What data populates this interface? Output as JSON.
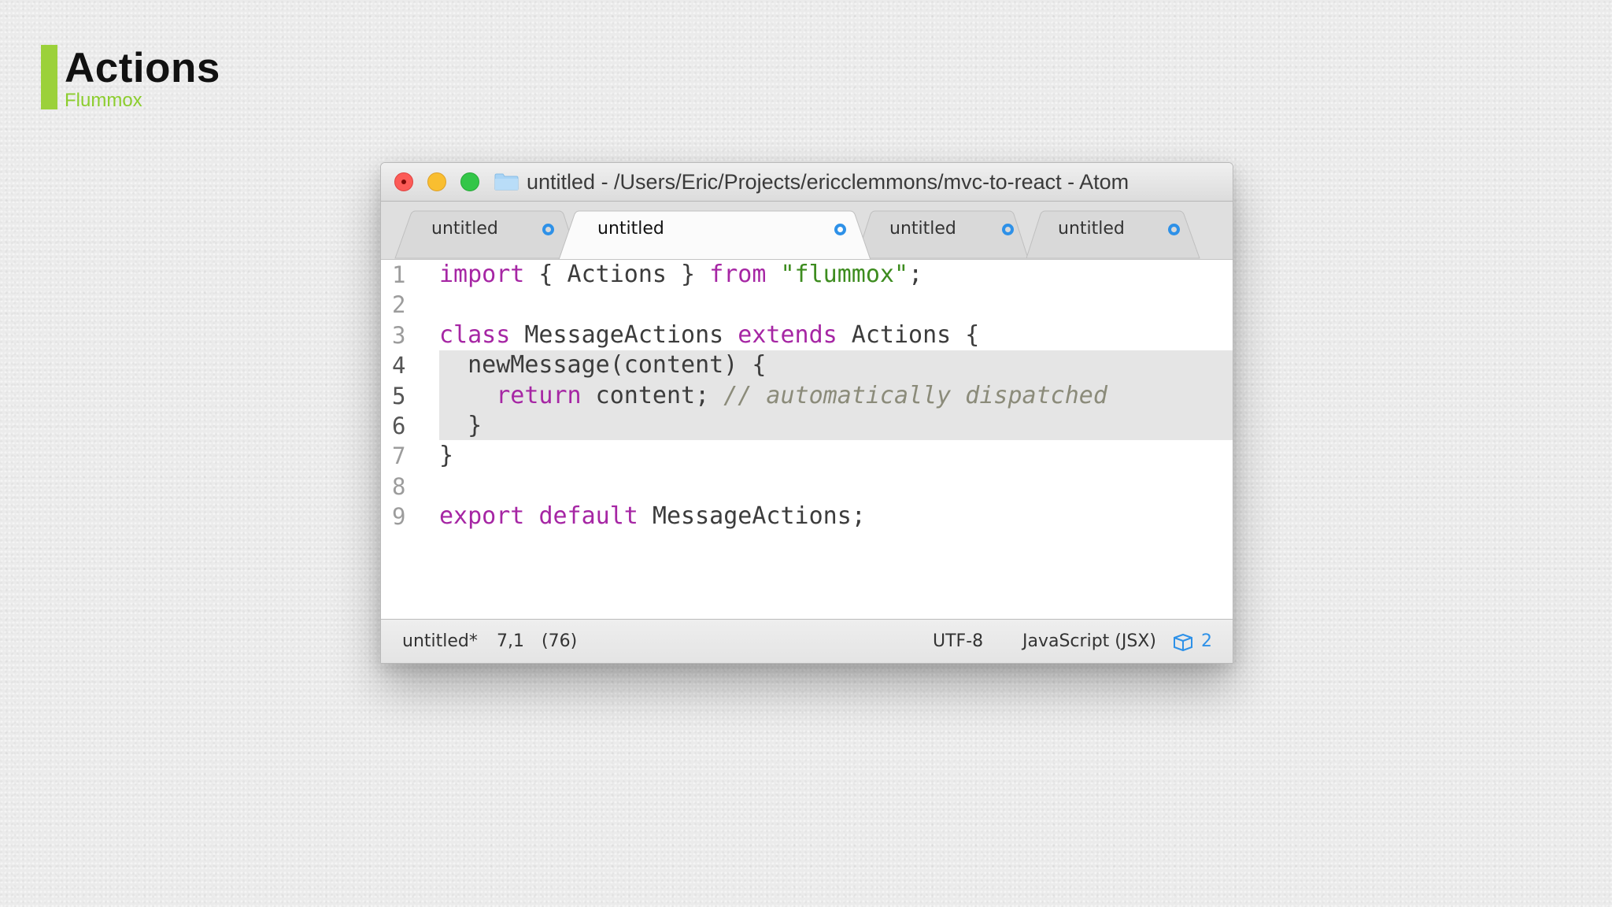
{
  "slide": {
    "title": "Actions",
    "subtitle": "Flummox",
    "accent_color": "#9bd13a"
  },
  "window": {
    "title": "untitled - /Users/Eric/Projects/ericclemmons/mvc-to-react - Atom",
    "traffic_lights": [
      "close",
      "minimize",
      "zoom"
    ],
    "folder_icon": "folder-icon"
  },
  "tabs": [
    {
      "label": "untitled",
      "active": false,
      "modified": true
    },
    {
      "label": "untitled",
      "active": true,
      "modified": true
    },
    {
      "label": "untitled",
      "active": false,
      "modified": true
    },
    {
      "label": "untitled",
      "active": false,
      "modified": true
    }
  ],
  "editor": {
    "lines": [
      {
        "num": "1",
        "tokens": [
          {
            "t": "import",
            "c": "kw"
          },
          {
            "t": " { Actions } ",
            "c": ""
          },
          {
            "t": "from",
            "c": "kw"
          },
          {
            "t": " ",
            "c": ""
          },
          {
            "t": "\"flummox\"",
            "c": "str"
          },
          {
            "t": ";",
            "c": ""
          }
        ]
      },
      {
        "num": "2",
        "tokens": []
      },
      {
        "num": "3",
        "tokens": [
          {
            "t": "class",
            "c": "kw"
          },
          {
            "t": " MessageActions ",
            "c": ""
          },
          {
            "t": "extends",
            "c": "kw"
          },
          {
            "t": " Actions {",
            "c": ""
          }
        ]
      },
      {
        "num": "4",
        "tokens": [
          {
            "t": "  newMessage(content) {",
            "c": ""
          }
        ]
      },
      {
        "num": "5",
        "tokens": [
          {
            "t": "    ",
            "c": ""
          },
          {
            "t": "return",
            "c": "kw"
          },
          {
            "t": " content; ",
            "c": ""
          },
          {
            "t": "// automatically dispatched",
            "c": "cmt"
          }
        ]
      },
      {
        "num": "6",
        "tokens": [
          {
            "t": "  }",
            "c": ""
          }
        ]
      },
      {
        "num": "7",
        "tokens": [
          {
            "t": "}",
            "c": ""
          }
        ]
      },
      {
        "num": "8",
        "tokens": []
      },
      {
        "num": "9",
        "tokens": [
          {
            "t": "export",
            "c": "kw"
          },
          {
            "t": " ",
            "c": ""
          },
          {
            "t": "default",
            "c": "kw"
          },
          {
            "t": " MessageActions;",
            "c": ""
          }
        ]
      }
    ],
    "highlighted_lines": [
      "4",
      "5",
      "6"
    ]
  },
  "status": {
    "file": "untitled*",
    "cursor": "7,1",
    "selection": "(76)",
    "encoding": "UTF-8",
    "grammar": "JavaScript (JSX)",
    "package_icon": "package-icon",
    "package_count": "2"
  }
}
